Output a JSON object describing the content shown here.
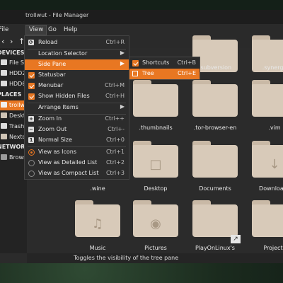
{
  "window": {
    "title": "trollwut - File Manager"
  },
  "menubar": {
    "items": [
      "File",
      "View",
      "Go",
      "Help"
    ],
    "active": "View"
  },
  "sidebar": {
    "devices_header": "DEVICES",
    "devices": [
      "File System",
      "HDD2",
      "HDD6"
    ],
    "places_header": "PLACES",
    "places": [
      "trollwut",
      "Desktop",
      "Trash",
      "Nextcloud"
    ],
    "network_header": "NETWORK",
    "network": [
      "Browse Network"
    ]
  },
  "view_menu": {
    "items": [
      {
        "label": "Reload",
        "shortcut": "Ctrl+R",
        "icon": "reload-icon"
      },
      {
        "label": "Location Selector",
        "submenu": true
      },
      {
        "label": "Side Pane",
        "submenu": true,
        "selected": true
      },
      {
        "label": "Statusbar",
        "checked": true
      },
      {
        "label": "Menubar",
        "shortcut": "Ctrl+M",
        "checked": true
      },
      {
        "label": "Show Hidden Files",
        "shortcut": "Ctrl+H",
        "checked": true
      },
      {
        "label": "Arrange Items",
        "submenu": true
      },
      {
        "label": "Zoom In",
        "shortcut": "Ctrl++"
      },
      {
        "label": "Zoom Out",
        "shortcut": "Ctrl+-"
      },
      {
        "label": "Normal Size",
        "shortcut": "Ctrl+0"
      },
      {
        "label": "View as Icons",
        "shortcut": "Ctrl+1",
        "radio": true,
        "on": true
      },
      {
        "label": "View as Detailed List",
        "shortcut": "Ctrl+2",
        "radio": true
      },
      {
        "label": "View as Compact List",
        "shortcut": "Ctrl+3",
        "radio": true
      }
    ]
  },
  "side_pane_submenu": {
    "items": [
      {
        "label": "Shortcuts",
        "shortcut": "Ctrl+B",
        "checked": true
      },
      {
        "label": "Tree",
        "shortcut": "Ctrl+E",
        "selected": true
      }
    ]
  },
  "folders": {
    "row1": [
      ".subversion",
      ".synergy"
    ],
    "row2": [
      ".thumbnails",
      ".tor-browser-en",
      ".vim"
    ],
    "row3": [
      ".wine",
      "Desktop",
      "Documents",
      "Downloads"
    ],
    "row4": [
      "Music",
      "Pictures",
      "PlayOnLinux's",
      "Projects"
    ]
  },
  "statusbar": {
    "text": "Toggles the visibility of the tree pane"
  },
  "colors": {
    "accent": "#e87722",
    "folder": "#d8cab9"
  }
}
